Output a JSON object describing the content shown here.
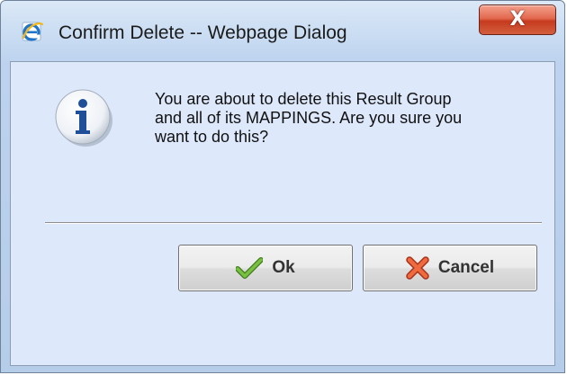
{
  "window": {
    "title": "Confirm Delete -- Webpage Dialog",
    "title_icon": "internet-explorer-icon",
    "close_icon": "close-icon",
    "close_label": "X"
  },
  "dialog": {
    "icon": "info-icon",
    "message_lines": [
      "You are about to delete this Result Group",
      "and all of its MAPPINGS. Are you sure you",
      "want to do this?"
    ]
  },
  "buttons": {
    "ok_label": "Ok",
    "ok_icon": "checkmark-icon",
    "cancel_label": "Cancel",
    "cancel_icon": "red-x-icon"
  },
  "colors": {
    "client_background": "#dde8fb",
    "close_button": "#c63a1e",
    "ok_check": "#5aa02c",
    "cancel_x": "#e0532c"
  }
}
